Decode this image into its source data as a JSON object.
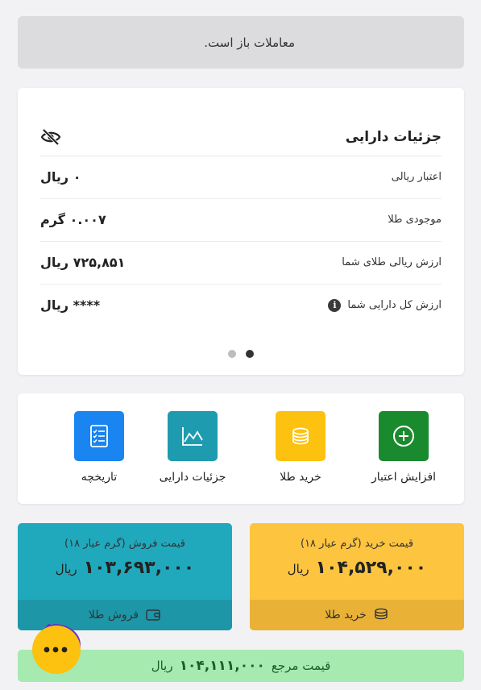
{
  "banner": {
    "text": "معاملات باز است."
  },
  "assets": {
    "title": "جزئیات دارایی",
    "rows": [
      {
        "label": "اعتبار ریالی",
        "value": "۰ ریال"
      },
      {
        "label": "موجودی طلا",
        "value": "۰.۰۰۷ گرم"
      },
      {
        "label": "ارزش ریالی طلای شما",
        "value": "۷۲۵,۸۵۱ ریال"
      },
      {
        "label": "ارزش کل دارایی شما",
        "value": "**** ریال"
      }
    ]
  },
  "actions": [
    {
      "label": "افزایش اعتبار",
      "icon": "plus-circle-icon",
      "color": "#1a8a2e"
    },
    {
      "label": "خرید طلا",
      "icon": "coins-icon",
      "color": "#fdc10f"
    },
    {
      "label": "جزئیات دارایی",
      "icon": "chart-icon",
      "color": "#1f9bb0"
    },
    {
      "label": "تاریخچه",
      "icon": "list-icon",
      "color": "#1a84f0"
    }
  ],
  "buy": {
    "caption": "قیمت خرید (گرم عیار ۱۸)",
    "amount": "۱۰۴,۵۲۹,۰۰۰",
    "unit": "ریال",
    "button": "خرید طلا"
  },
  "sell": {
    "caption": "قیمت فروش (گرم عیار ۱۸)",
    "amount": "۱۰۳,۶۹۳,۰۰۰",
    "unit": "ریال",
    "button": "فروش طلا"
  },
  "reference": {
    "label": "قیمت مرجع",
    "amount": "۱۰۴,۱۱۱,۰۰۰",
    "unit": "ریال"
  },
  "colors": {
    "buy": "#fdc43f",
    "sell": "#20a9bd",
    "reference": "#a6eab0",
    "chat": "#6b2bd6"
  }
}
